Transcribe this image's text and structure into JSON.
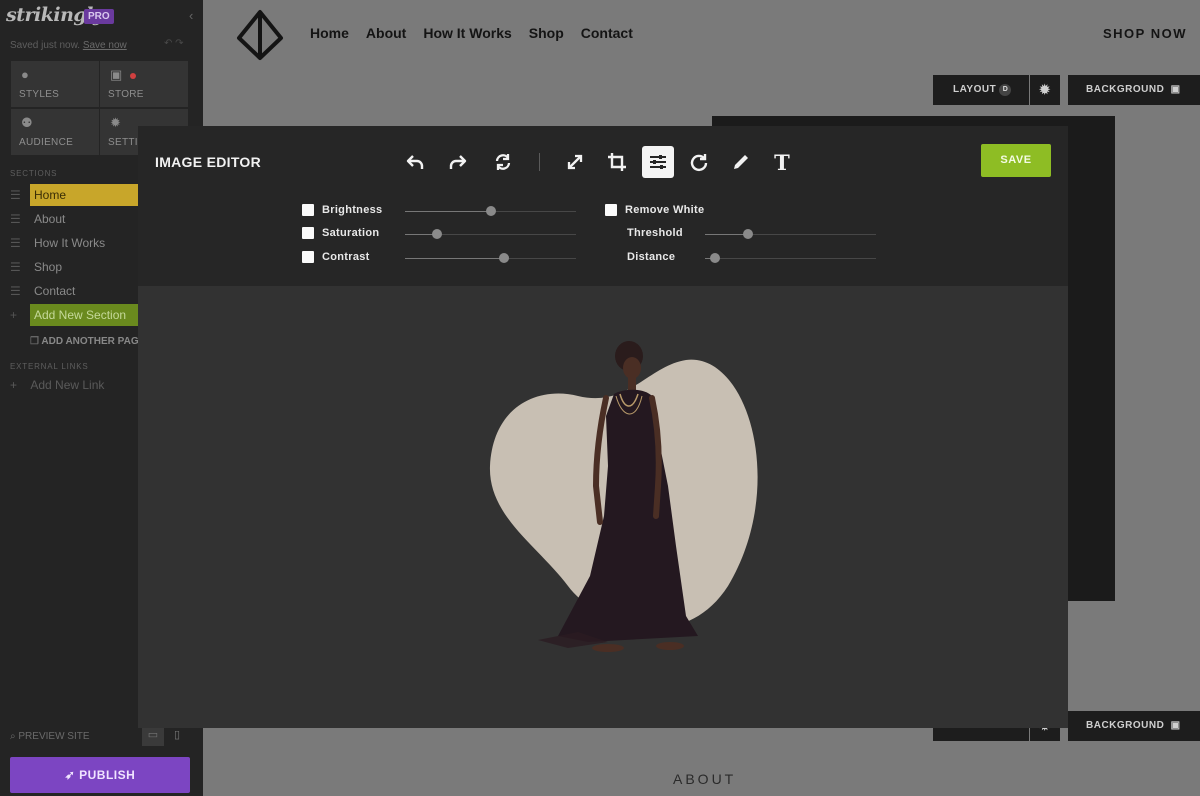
{
  "sidebar": {
    "logo": "strikingly",
    "plan_badge": "PRO",
    "saved_status": "Saved just now.",
    "save_now": "Save now",
    "tiles": [
      {
        "label": "STYLES",
        "icon": "palette-icon"
      },
      {
        "label": "STORE",
        "icon": "bag-icon"
      },
      {
        "label": "AUDIENCE",
        "icon": "users-icon"
      },
      {
        "label": "SETTINGS",
        "icon": "gear-icon"
      }
    ],
    "sections_label": "SECTIONS",
    "sections": [
      "Home",
      "About",
      "How It Works",
      "Shop",
      "Contact"
    ],
    "add_section": "Add New Section",
    "add_page": "ADD ANOTHER PAGE",
    "external_links_label": "EXTERNAL LINKS",
    "add_link": "Add New Link",
    "preview_site": "PREVIEW SITE",
    "publish": "PUBLISH"
  },
  "site": {
    "nav": [
      "Home",
      "About",
      "How It Works",
      "Shop",
      "Contact"
    ],
    "cta": "SHOP NOW",
    "layout_button": "LAYOUT",
    "layout_badge": "D",
    "background_button": "BACKGROUND",
    "section_heading": "ABOUT"
  },
  "editor": {
    "title": "IMAGE EDITOR",
    "tools": [
      "undo-icon",
      "redo-icon",
      "reset-icon",
      "resize-icon",
      "crop-icon",
      "adjust-icon",
      "rotate-icon",
      "draw-icon",
      "text-icon"
    ],
    "selected_tool": "adjust-icon",
    "save": "SAVE",
    "adjustments": [
      {
        "label": "Brightness",
        "value": 0.5
      },
      {
        "label": "Saturation",
        "value": 0.19
      },
      {
        "label": "Contrast",
        "value": 0.58
      }
    ],
    "remove_white": {
      "label": "Remove White",
      "threshold_label": "Threshold",
      "threshold": 0.25,
      "distance_label": "Distance",
      "distance": 0.06
    }
  },
  "colors": {
    "accent_green": "#8ebd24",
    "publish_purple": "#7c45c2",
    "active_section": "#c8a62a"
  }
}
